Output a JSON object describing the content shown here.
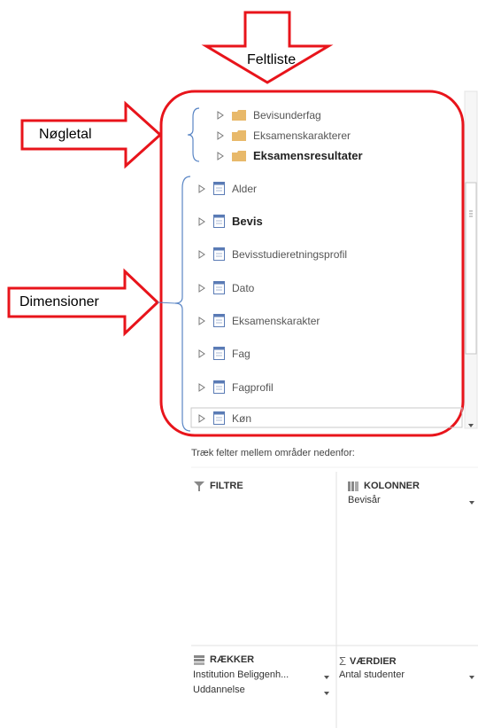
{
  "callouts": {
    "feltliste": "Feltliste",
    "nogletal": "Nøgletal",
    "dimensioner": "Dimensioner"
  },
  "measure_groups": [
    {
      "label": "Bevisunderfag",
      "bold": false
    },
    {
      "label": "Eksamenskarakterer",
      "bold": false
    },
    {
      "label": "Eksamensresultater",
      "bold": true
    }
  ],
  "dimensions": [
    {
      "label": "Alder",
      "bold": false
    },
    {
      "label": "Bevis",
      "bold": true
    },
    {
      "label": "Bevisstudieretningsprofil",
      "bold": false
    },
    {
      "label": "Dato",
      "bold": false
    },
    {
      "label": "Eksamenskarakter",
      "bold": false
    },
    {
      "label": "Fag",
      "bold": false
    },
    {
      "label": "Fagprofil",
      "bold": false
    },
    {
      "label": "Køn",
      "bold": false
    }
  ],
  "drag_hint": "Træk felter mellem områder nedenfor:",
  "areas": {
    "filters": {
      "title": "FILTRE",
      "icon": "filter-icon",
      "fields": []
    },
    "columns": {
      "title": "KOLONNER",
      "icon": "columns-icon",
      "fields": [
        "Bevisår"
      ]
    },
    "rows": {
      "title": "RÆKKER",
      "icon": "rows-icon",
      "fields": [
        "Institution Beliggenh...",
        "Uddannelse"
      ]
    },
    "values": {
      "title": "VÆRDIER",
      "icon": "sigma-icon",
      "fields": [
        "Antal studenter"
      ]
    }
  },
  "colors": {
    "callout_red": "#e8141b",
    "folder": "#e8b96a",
    "table_icon": "#5a7bb5"
  }
}
